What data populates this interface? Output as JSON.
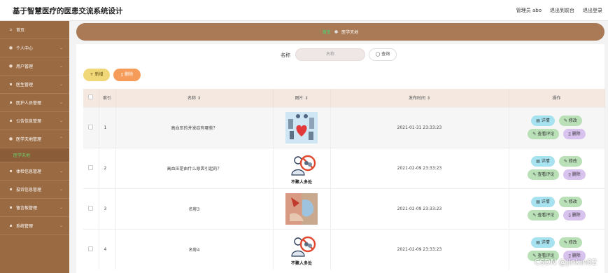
{
  "app_title": "基于智慧医疗的医患交流系统设计",
  "top_links": [
    "管理员 abo",
    "退出到前台",
    "退出登录"
  ],
  "sidebar": {
    "items": [
      {
        "label": "首页",
        "icon": "home-icon"
      },
      {
        "label": "个人中心",
        "icon": "person-icon"
      },
      {
        "label": "用户管理",
        "icon": "user-icon"
      },
      {
        "label": "医生管理",
        "icon": "doctor-icon"
      },
      {
        "label": "医护人员管理",
        "icon": "staff-icon"
      },
      {
        "label": "公告信息管理",
        "icon": "notice-icon"
      },
      {
        "label": "医学天地管理",
        "icon": "medical-icon"
      },
      {
        "label": "医学天地",
        "icon": "",
        "sub": true,
        "active": true
      },
      {
        "label": "体检信息管理",
        "icon": "checkup-icon"
      },
      {
        "label": "投诉信息管理",
        "icon": "complaint-icon"
      },
      {
        "label": "留言板管理",
        "icon": "message-icon"
      },
      {
        "label": "系统管理",
        "icon": "settings-icon"
      }
    ]
  },
  "breadcrumb": {
    "home": "首页",
    "current": "医学天地"
  },
  "search": {
    "label": "名称",
    "placeholder": "名称",
    "button": "查询"
  },
  "toolbar": {
    "add": "新增",
    "delete": "删除"
  },
  "table": {
    "headers": [
      "索引",
      "名称",
      "图片",
      "发布时间",
      "操作"
    ],
    "rows": [
      {
        "index": "1",
        "name": "高血压的并发症有哪些？",
        "image": "hypertension-illustration",
        "time": "2021-01-31 23:33:23"
      },
      {
        "index": "2",
        "name": "高血压是由什么原因引起的？",
        "image": "no-gathering-illustration",
        "time": "2021-02-09 23:33:23"
      },
      {
        "index": "3",
        "name": "名称3",
        "image": "care-hands-photo",
        "time": "2021-02-09 23:33:23"
      },
      {
        "index": "4",
        "name": "名称4",
        "image": "no-gathering-illustration",
        "time": "2021-02-09 23:33:23"
      }
    ],
    "actions": {
      "detail": "详情",
      "edit": "修改",
      "comment": "查看评论",
      "delete": "删除"
    }
  },
  "no_gathering_caption": "不聚人多处",
  "watermark": "CSDN @jinkin02",
  "colors": {
    "sidebar": "#9a6a43",
    "breadcrumb": "#a97a55",
    "header_row": "#f5e8e1",
    "accent_green": "#3ddc7a",
    "add_button": "#f0d777",
    "delete_button": "#f59c5a"
  }
}
